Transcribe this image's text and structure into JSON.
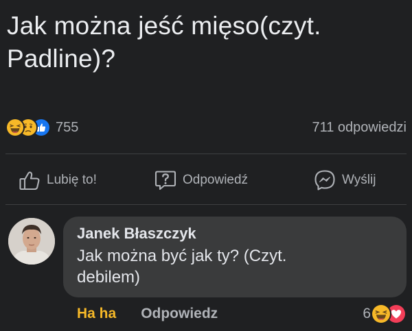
{
  "question": {
    "title": "Jak można jeść mięso(czyt. Padline)?"
  },
  "reactions_summary": {
    "icons": [
      "haha-emoji-icon",
      "sad-emoji-icon",
      "like-thumb-icon"
    ],
    "count": "755",
    "answers": "711 odpowiedzi"
  },
  "action_bar": {
    "like_label": "Lubię to!",
    "reply_label": "Odpowiedź",
    "send_label": "Wyślij"
  },
  "comment": {
    "author": "Janek Błaszczyk",
    "text": "Jak można być jak ty? (Czyt. debilem)",
    "haha_label": "Ha ha",
    "reply_label": "Odpowiedz",
    "reaction_count": "6",
    "reaction_icons": [
      "haha-emoji-icon",
      "love-heart-icon"
    ]
  },
  "colors": {
    "background": "#1f2022",
    "bubble": "#3a3b3c",
    "text_primary": "#e4e6eb",
    "text_secondary": "#b0b3b8",
    "haha_accent": "#f7b928",
    "like_blue": "#1877f2",
    "love_red": "#f33e58"
  }
}
